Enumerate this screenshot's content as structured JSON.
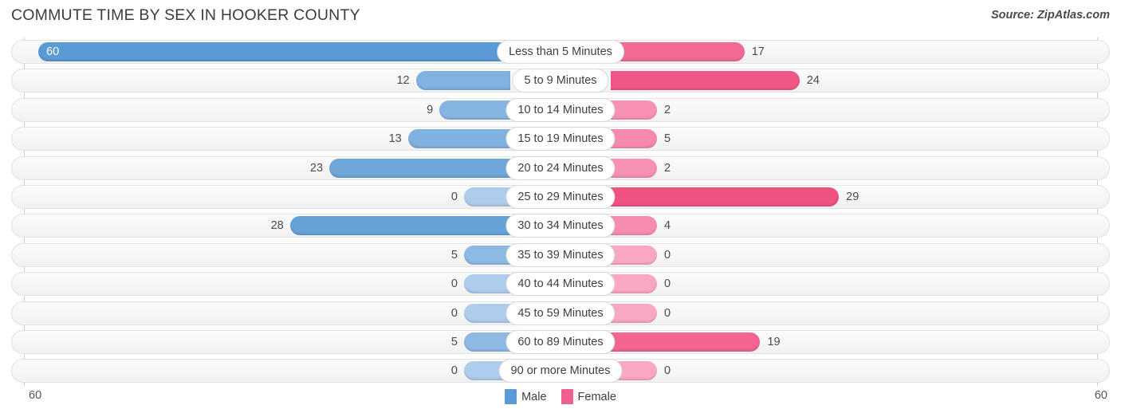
{
  "header": {
    "title": "COMMUTE TIME BY SEX IN HOOKER COUNTY",
    "source": "Source: ZipAtlas.com"
  },
  "axis": {
    "left_tick": "60",
    "right_tick": "60",
    "max": 60
  },
  "legend": {
    "items": [
      {
        "label": "Male",
        "color": "#5b9bd5"
      },
      {
        "label": "Female",
        "color": "#ef5f90"
      }
    ]
  },
  "colors": {
    "male_strong": "#5b9bd5",
    "male_light": "#aeccec",
    "female_strong": "#ef5280",
    "female_light": "#f9a7c5",
    "track_border": "#e2e2e2",
    "axis": "#cdcdcd",
    "title": "#3c3c3c"
  },
  "chart_data": {
    "type": "bar",
    "title": "COMMUTE TIME BY SEX IN HOOKER COUNTY",
    "subtitle": "",
    "orientation": "horizontal-diverging",
    "xlabel": "",
    "ylabel": "",
    "xlim": [
      60,
      60
    ],
    "grid": false,
    "legend_position": "bottom-center",
    "categories": [
      "Less than 5 Minutes",
      "5 to 9 Minutes",
      "10 to 14 Minutes",
      "15 to 19 Minutes",
      "20 to 24 Minutes",
      "25 to 29 Minutes",
      "30 to 34 Minutes",
      "35 to 39 Minutes",
      "40 to 44 Minutes",
      "45 to 59 Minutes",
      "60 to 89 Minutes",
      "90 or more Minutes"
    ],
    "series": [
      {
        "name": "Male",
        "color": "#5b9bd5",
        "side": "left",
        "values": [
          60,
          12,
          9,
          13,
          23,
          0,
          28,
          5,
          0,
          0,
          5,
          0
        ]
      },
      {
        "name": "Female",
        "color": "#ef5f90",
        "side": "right",
        "values": [
          17,
          24,
          2,
          5,
          2,
          29,
          4,
          0,
          0,
          0,
          19,
          0
        ]
      }
    ]
  },
  "rows": [
    {
      "label": "Less than 5 Minutes",
      "male": "60",
      "female": "17"
    },
    {
      "label": "5 to 9 Minutes",
      "male": "12",
      "female": "24"
    },
    {
      "label": "10 to 14 Minutes",
      "male": "9",
      "female": "2"
    },
    {
      "label": "15 to 19 Minutes",
      "male": "13",
      "female": "5"
    },
    {
      "label": "20 to 24 Minutes",
      "male": "23",
      "female": "2"
    },
    {
      "label": "25 to 29 Minutes",
      "male": "0",
      "female": "29"
    },
    {
      "label": "30 to 34 Minutes",
      "male": "28",
      "female": "4"
    },
    {
      "label": "35 to 39 Minutes",
      "male": "5",
      "female": "0"
    },
    {
      "label": "40 to 44 Minutes",
      "male": "0",
      "female": "0"
    },
    {
      "label": "45 to 59 Minutes",
      "male": "0",
      "female": "0"
    },
    {
      "label": "60 to 89 Minutes",
      "male": "5",
      "female": "19"
    },
    {
      "label": "90 or more Minutes",
      "male": "0",
      "female": "0"
    }
  ]
}
